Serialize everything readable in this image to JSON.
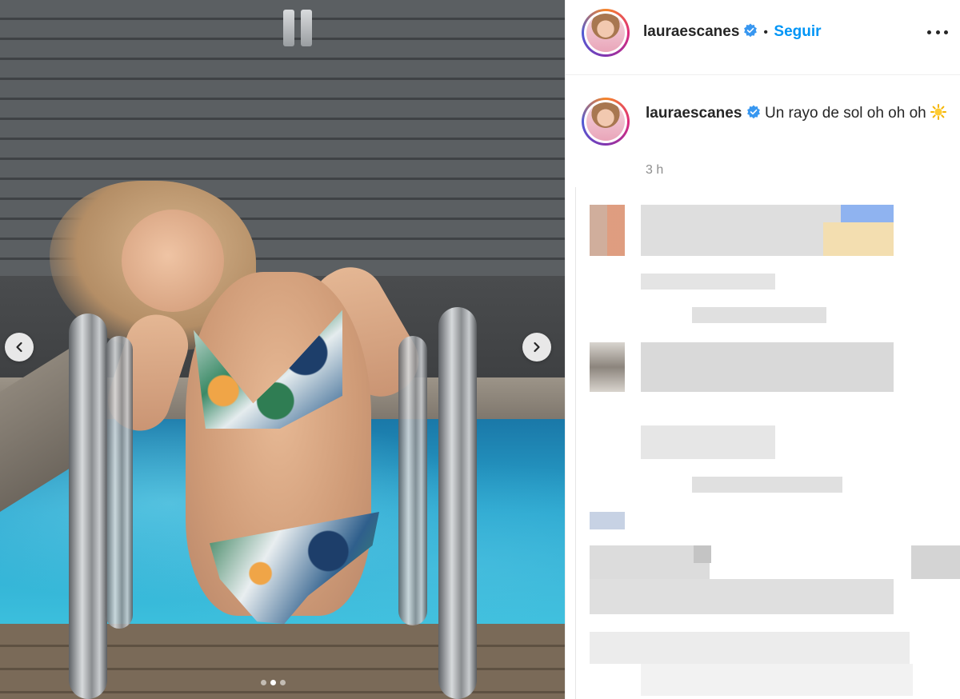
{
  "post": {
    "image_alt": "",
    "carousel": {
      "current": 2,
      "total": 3
    }
  },
  "header": {
    "username": "lauraescanes",
    "separator": "•",
    "follow_label": "Seguir"
  },
  "caption": {
    "username": "lauraescanes",
    "text": "Un rayo de sol oh oh oh",
    "emoji": "sun-icon",
    "time": "3 h"
  },
  "colors": {
    "accent": "#0095f6",
    "verified": "#3897f0",
    "muted_text": "#8e8e8e",
    "text": "#262626"
  },
  "icons": [
    "chevron-left-icon",
    "chevron-right-icon",
    "verified-badge-icon",
    "more-options-icon",
    "sun-icon"
  ]
}
